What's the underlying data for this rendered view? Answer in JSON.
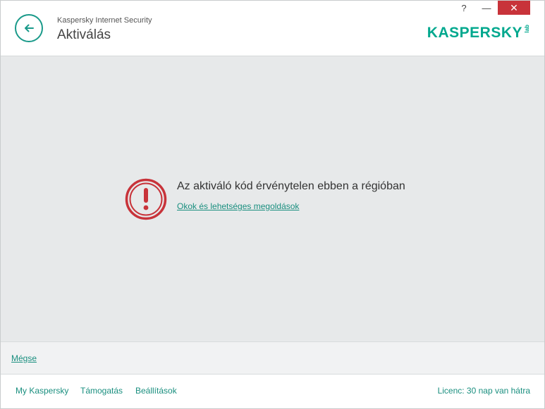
{
  "window": {
    "app_name": "Kaspersky Internet Security",
    "page_title": "Aktiválás",
    "controls": {
      "help": "?",
      "minimize": "—",
      "close": "✕"
    },
    "logo_text": "KASPERSKY",
    "logo_suffix": "lab"
  },
  "main": {
    "error_message": "Az aktiváló kód érvénytelen ebben a régióban",
    "error_link": "Okok és lehetséges megoldások"
  },
  "cancel": {
    "label": "Mégse"
  },
  "footer": {
    "links": [
      "My Kaspersky",
      "Támogatás",
      "Beállítások"
    ],
    "license": "Licenc: 30 nap van hátra"
  },
  "colors": {
    "accent": "#1a9a8a",
    "error": "#c8333a",
    "background": "#e7e9ea"
  },
  "icons": {
    "back": "back-arrow-icon",
    "error": "exclamation-circle-icon"
  }
}
